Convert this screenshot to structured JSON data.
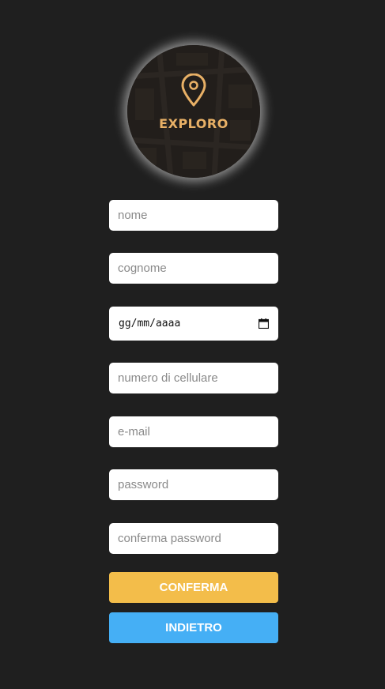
{
  "logo": {
    "text": "EXPLORO",
    "accent_color": "#e8b066"
  },
  "form": {
    "name_placeholder": "nome",
    "surname_placeholder": "cognome",
    "birthdate_placeholder": "gg/mm/aaaa",
    "phone_placeholder": "numero di cellulare",
    "email_placeholder": "e-mail",
    "password_placeholder": "password",
    "confirm_password_placeholder": "conferma password"
  },
  "buttons": {
    "confirm_label": "CONFERMA",
    "confirm_color": "#f3bd4a",
    "back_label": "INDIETRO",
    "back_color": "#45aff5"
  },
  "icons": {
    "logo_pin": "map-pin-icon",
    "date_picker": "calendar-icon"
  }
}
